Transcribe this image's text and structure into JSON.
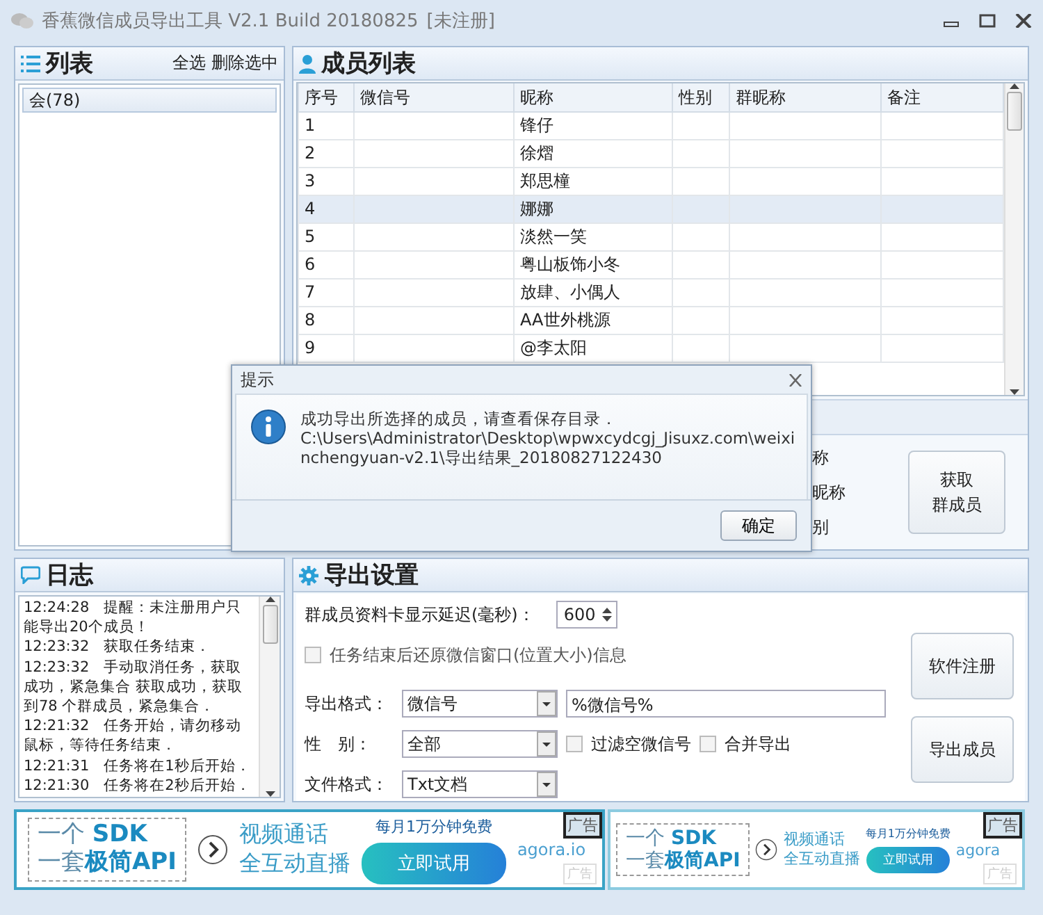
{
  "window": {
    "title": "香蕉微信成员导出工具 V2.1 Build 20180825",
    "status": "[未注册]"
  },
  "group_list": {
    "title": "列表",
    "actions": [
      "全选",
      "删除选中"
    ],
    "items": [
      {
        "label": "会(78)",
        "selected": true
      }
    ]
  },
  "members": {
    "title": "成员列表",
    "columns": [
      "序号",
      "微信号",
      "昵称",
      "性别",
      "群昵称",
      "备注"
    ],
    "rows": [
      {
        "cells": [
          "1",
          "",
          "锋仔",
          "",
          "",
          ""
        ],
        "selected": false
      },
      {
        "cells": [
          "2",
          "",
          "徐熠",
          "",
          "",
          ""
        ],
        "selected": false
      },
      {
        "cells": [
          "3",
          "",
          "郑思橦",
          "",
          "",
          ""
        ],
        "selected": false
      },
      {
        "cells": [
          "4",
          "",
          "娜娜",
          "",
          "",
          ""
        ],
        "selected": true
      },
      {
        "cells": [
          "5",
          "",
          "淡然一笑",
          "",
          "",
          ""
        ],
        "selected": false
      },
      {
        "cells": [
          "6",
          "",
          "粤山板饰小冬",
          "",
          "",
          ""
        ],
        "selected": false
      },
      {
        "cells": [
          "7",
          "",
          "放肆、小偶人",
          "",
          "",
          ""
        ],
        "selected": false
      },
      {
        "cells": [
          "8",
          "",
          "AA世外桃源",
          "",
          "",
          ""
        ],
        "selected": false
      },
      {
        "cells": [
          "9",
          "",
          "@李太阳",
          "",
          "",
          ""
        ],
        "selected": false
      }
    ],
    "options": [
      "称",
      "昵称",
      "别"
    ],
    "button": [
      "获取",
      "群成员"
    ]
  },
  "log": {
    "title": "日志",
    "entries": [
      {
        "time": "12:24:28",
        "text": "提醒：未注册用户只能导出20个成员！"
      },
      {
        "time": "12:23:32",
        "text": "获取任务结束．"
      },
      {
        "time": "12:23:32",
        "text": "手动取消任务，获取成功，紧急集合 获取成功，获取到78 个群成员，紧急集合．"
      },
      {
        "time": "12:21:32",
        "text": "任务开始，请勿移动鼠标，等待任务结束．"
      },
      {
        "time": "12:21:31",
        "text": "任务将在1秒后开始．"
      },
      {
        "time": "12:21:30",
        "text": "任务将在2秒后开始．"
      }
    ]
  },
  "export_settings": {
    "title": "导出设置",
    "delay_label": "群成员资料卡显示延迟(毫秒)：",
    "delay_value": "600",
    "restore_window": {
      "label": "任务结束后还原微信窗口(位置大小)信息",
      "checked": false
    },
    "format": {
      "label": "导出格式：",
      "value": "微信号",
      "template": "%微信号%"
    },
    "gender": {
      "label": "性　别：",
      "value": "全部"
    },
    "filter_empty": {
      "label": "过滤空微信号",
      "checked": false
    },
    "merge": {
      "label": "合并导出",
      "checked": false
    },
    "file_format": {
      "label": "文件格式：",
      "value": "Txt文档"
    },
    "buttons": [
      "软件注册",
      "导出成员"
    ]
  },
  "ads": [
    {
      "line1a": "一个 ",
      "line1b": "SDK",
      "line2a": "一套",
      "line2b": "极简API",
      "slogan1": "视频通话",
      "slogan2": "全互动直播",
      "offer": "每月1万分钟免费",
      "cta": "立即试用",
      "brand": "agora.io",
      "badge": "广告",
      "tag": "广告"
    },
    {
      "line1a": "一个 ",
      "line1b": "SDK",
      "line2a": "一套",
      "line2b": "极简API",
      "slogan1": "视频通话",
      "slogan2": "全互动直播",
      "offer": "每月1万分钟免费",
      "cta": "立即试用",
      "brand": "agora",
      "badge": "广告",
      "tag": "广告"
    }
  ],
  "dialog": {
    "title": "提示",
    "message": "成功导出所选择的成员，请查看保存目录．",
    "path": "C:\\Users\\Administrator\\Desktop\\wpwxcydcgj_Jisuxz.com\\weixinchengyuan-v2.1\\导出结果_20180827122430",
    "button": "确定"
  }
}
